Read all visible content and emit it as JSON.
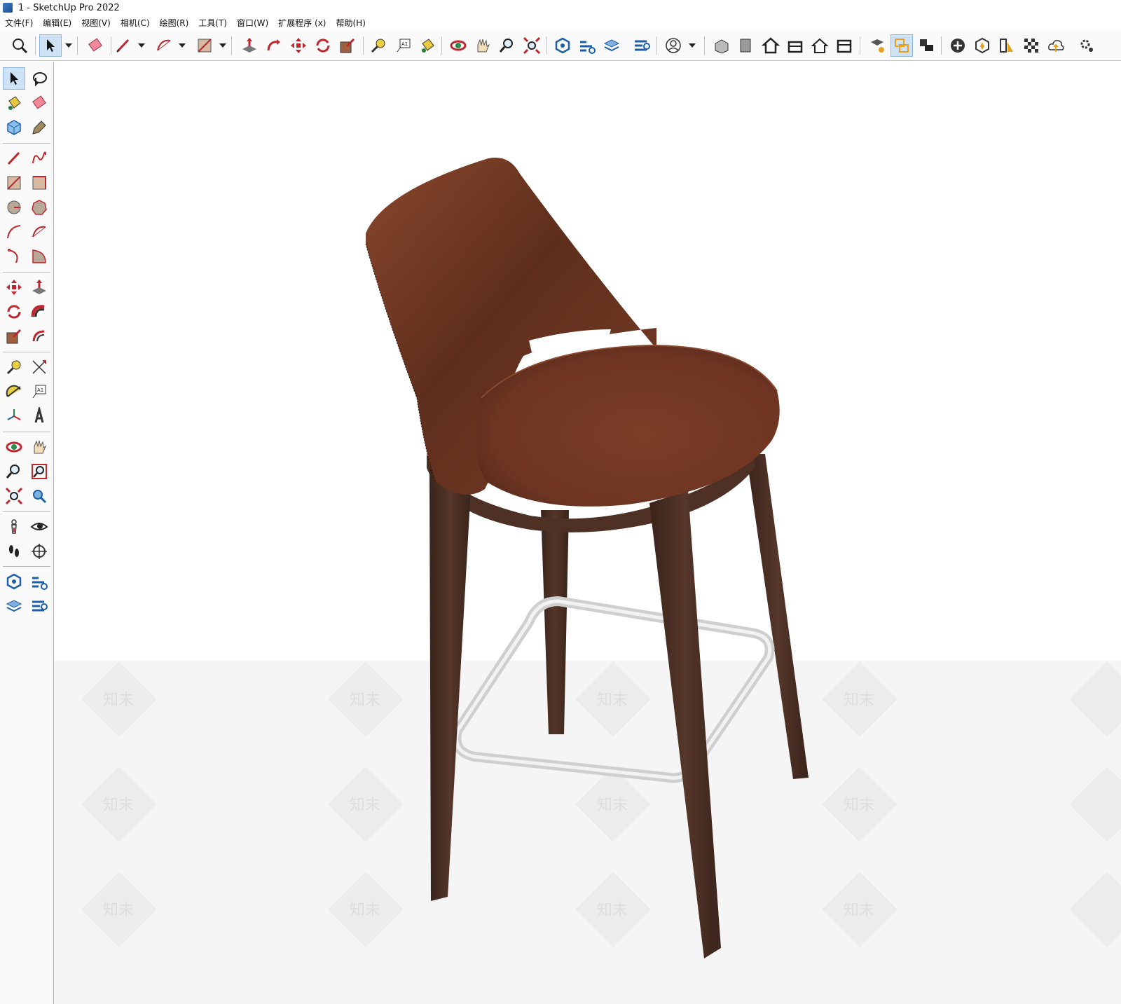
{
  "window": {
    "title": "1 - SketchUp Pro 2022"
  },
  "menu": [
    "文件(F)",
    "编辑(E)",
    "视图(V)",
    "相机(C)",
    "绘图(R)",
    "工具(T)",
    "窗口(W)",
    "扩展程序 (x)",
    "帮助(H)"
  ],
  "toolbar": {
    "active_tool": "select-tool",
    "buttons": [
      "search",
      "select",
      "eraser",
      "pencil",
      "arc",
      "rectangle",
      "push-pull",
      "follow-me",
      "move",
      "rotate",
      "scale",
      "tape-measure",
      "text",
      "paint-bucket",
      "orbit",
      "pan",
      "zoom",
      "zoom-extents",
      "warehouse",
      "extension-warehouse",
      "layout",
      "extension-manager",
      "account",
      "iso-view",
      "front-view",
      "top-view",
      "right-view",
      "back-view",
      "left-view",
      "styles",
      "outliner",
      "scenes",
      "add-location",
      "solid-inspector",
      "sandbox",
      "textures",
      "cloud",
      "settings"
    ]
  },
  "tools_palette": {
    "items": [
      "select",
      "orbit-lasso",
      "paint-bucket",
      "eraser",
      "component",
      "tag",
      "line",
      "freehand",
      "rectangle",
      "rotated-rectangle",
      "circle",
      "polygon",
      "arc",
      "two-point-arc",
      "three-point-arc",
      "pie",
      "move",
      "push-pull",
      "rotate",
      "follow-me",
      "scale",
      "offset",
      "tape-measure",
      "dimension",
      "protractor",
      "text",
      "axes",
      "3d-text",
      "orbit",
      "pan",
      "zoom",
      "zoom-window",
      "zoom-extents",
      "previous-view",
      "position-camera",
      "look-around",
      "walk",
      "section-plane",
      "warehouse",
      "extension-warehouse",
      "layout",
      "extension-manager"
    ]
  },
  "watermark": {
    "text": "知末"
  },
  "colors": {
    "leather": "#7a3d26",
    "wood": "#4a2e22",
    "metal": "#d8d8d8",
    "accent": "#cde2f5"
  }
}
